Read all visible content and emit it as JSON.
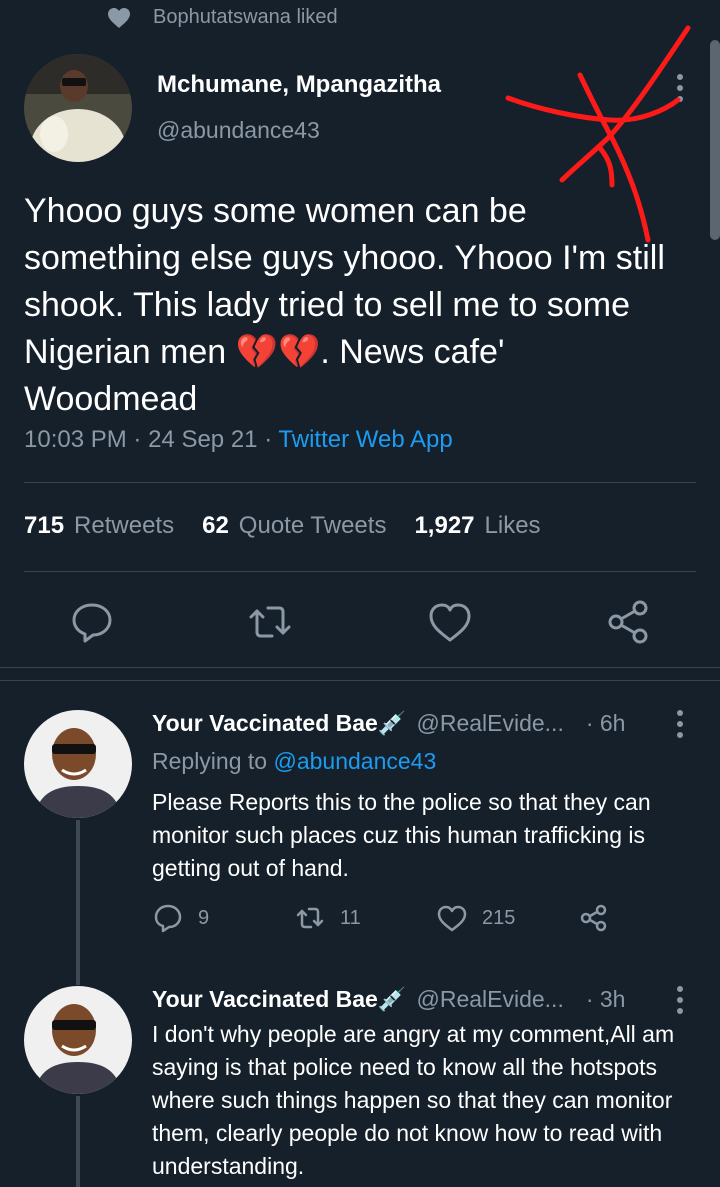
{
  "context": {
    "liked_text": "Bophutatswana liked"
  },
  "tweet": {
    "name": "Mchumane, Mpangazitha",
    "handle": "@abundance43",
    "text_1": "Yhooo guys some women can be something else guys yhooo. Yhooo I'm still shook. This lady tried to sell me to some Nigerian men ",
    "emoji": "💔💔",
    "text_2": ". News cafe' Woodmead",
    "time": "10:03 PM",
    "sep": "·",
    "date": "24 Sep 21",
    "source": "Twitter Web App",
    "stats": [
      {
        "count": "715",
        "label": "Retweets"
      },
      {
        "count": "62",
        "label": "Quote Tweets"
      },
      {
        "count": "1,927",
        "label": "Likes"
      }
    ],
    "icons": [
      "reply-icon",
      "retweet-icon",
      "like-icon",
      "share-icon"
    ]
  },
  "replies": [
    {
      "name": "Your Vaccinated Bae",
      "name_emoji": "💉",
      "handle": "@RealEvide...",
      "time": "· 6h",
      "replying_prefix": "Replying to ",
      "replying_handle": "@abundance43",
      "text": "Please Reports this to the police so that they can monitor such places cuz this human trafficking is getting out of hand.",
      "reply_count": "9",
      "retweet_count": "11",
      "like_count": "215"
    },
    {
      "name": "Your Vaccinated Bae",
      "name_emoji": "💉",
      "handle": "@RealEvide...",
      "time": "· 3h",
      "text": "I don't why people are angry at my comment,All am saying is that police need to know all the hotspots where such things happen so that they can monitor them, clearly people do not know how to read with understanding."
    }
  ],
  "colors": {
    "background": "#15202b",
    "muted": "#8b98a5",
    "link": "#1d9bf0",
    "scribble": "#ff1a1a"
  }
}
